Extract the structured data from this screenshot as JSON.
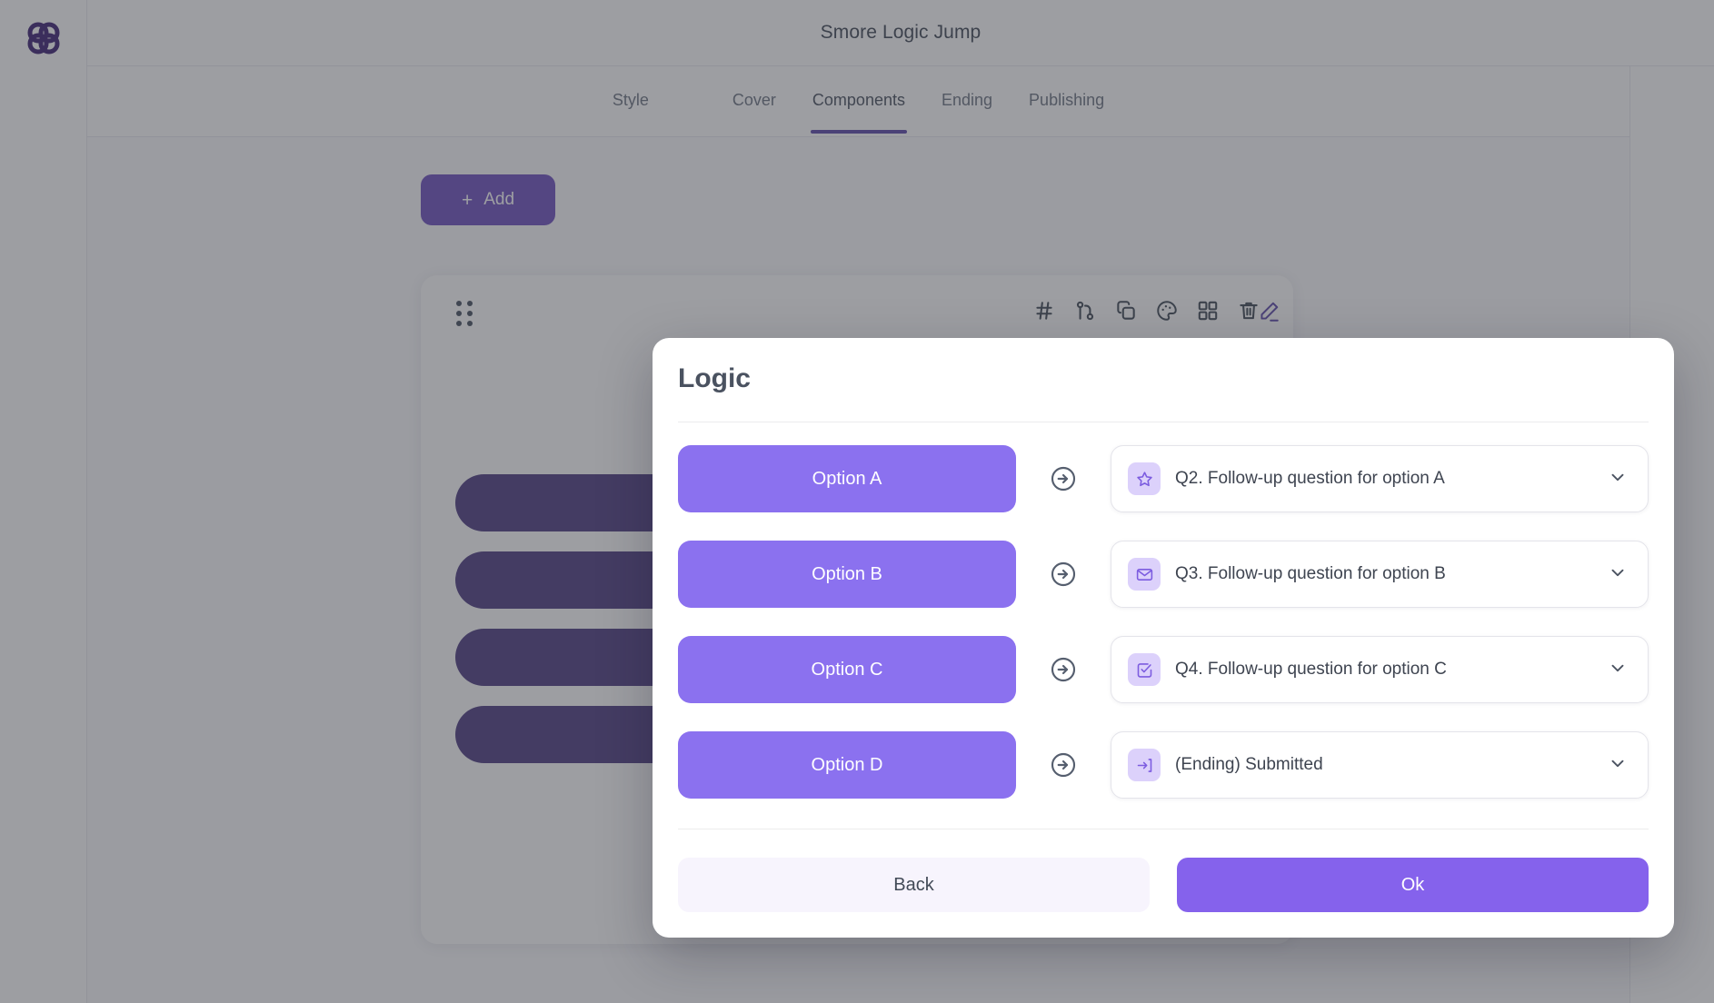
{
  "app": {
    "logo_name": "smore-logo",
    "accent_purple": "#8b71ef",
    "deep_purple": "#4d3b80",
    "tab_underline": "#5b46a8"
  },
  "header": {
    "title": "Smore Logic Jump"
  },
  "tabs": [
    {
      "label": "Style",
      "active": false
    },
    {
      "label": "Cover",
      "active": false
    },
    {
      "label": "Components",
      "active": true
    },
    {
      "label": "Ending",
      "active": false
    },
    {
      "label": "Publishing",
      "active": false
    }
  ],
  "canvas": {
    "add_button": {
      "label": "Add",
      "plus": "+"
    },
    "card": {
      "drag_handle": "drag-handle-icon",
      "edit_icon": "pencil-icon",
      "toolbar_icons": [
        "hash-icon",
        "logic-branch-icon",
        "duplicate-icon",
        "palette-icon",
        "layout-grid-icon",
        "trash-icon"
      ],
      "answer_pills": [
        "",
        "",
        "",
        ""
      ]
    }
  },
  "modal": {
    "title": "Logic",
    "rows": [
      {
        "option_label": "Option A",
        "arrow": "arrow-right-circle-icon",
        "target_icon": "star-icon",
        "target_label": "Q2. Follow-up question for option A",
        "chevron": "chevron-down-icon"
      },
      {
        "option_label": "Option B",
        "arrow": "arrow-right-circle-icon",
        "target_icon": "envelope-icon",
        "target_label": "Q3. Follow-up question for option B",
        "chevron": "chevron-down-icon"
      },
      {
        "option_label": "Option C",
        "arrow": "arrow-right-circle-icon",
        "target_icon": "checkbox-check-icon",
        "target_label": "Q4. Follow-up question for option C",
        "chevron": "chevron-down-icon"
      },
      {
        "option_label": "Option D",
        "arrow": "arrow-right-circle-icon",
        "target_icon": "exit-arrow-icon",
        "target_label": "(Ending) Submitted",
        "chevron": "chevron-down-icon"
      }
    ],
    "footer": {
      "back_label": "Back",
      "ok_label": "Ok"
    }
  }
}
